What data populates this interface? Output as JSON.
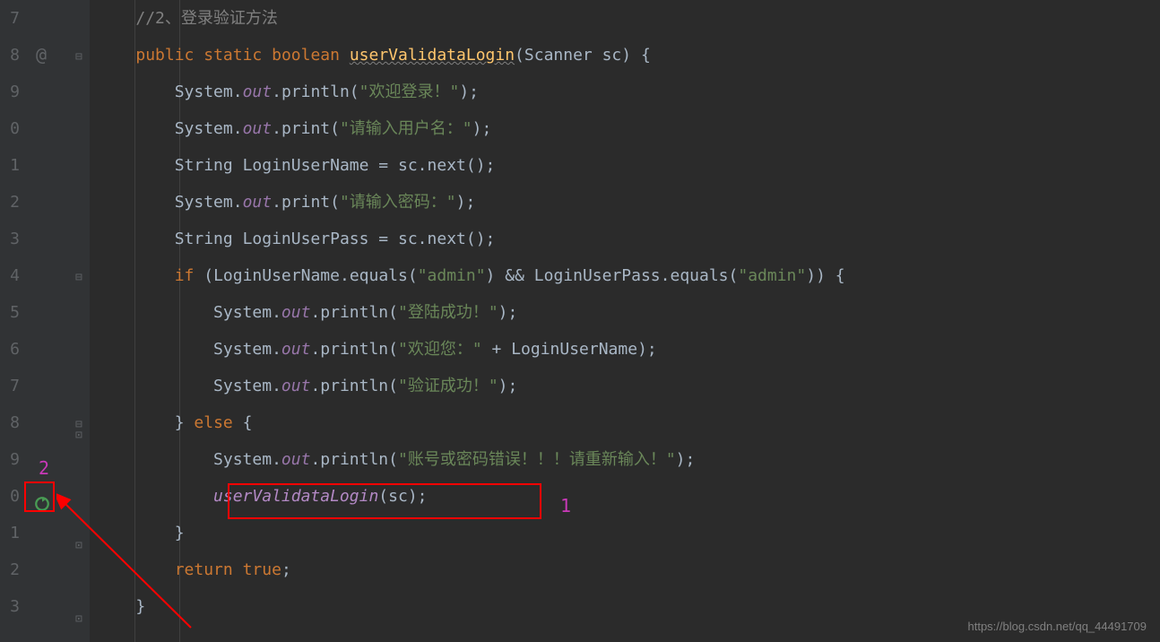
{
  "line_numbers": [
    "7",
    "8",
    "9",
    "0",
    "1",
    "2",
    "3",
    "4",
    "5",
    "6",
    "7",
    "8",
    "9",
    "0",
    "1",
    "2",
    "3"
  ],
  "code": {
    "comment_line": "//2、登录验证方法",
    "public": "public",
    "static": "static",
    "boolean": "boolean",
    "method_name": "userValidataLogin",
    "scanner": "Scanner",
    "sc": "sc",
    "system": "System",
    "out": "out",
    "println": "println",
    "print": "print",
    "str_welcome": "\"欢迎登录！\"",
    "str_username_prompt": "\"请输入用户名：\"",
    "string_type": "String",
    "loginUserName": "LoginUserName",
    "equals_assign": " = ",
    "next": "next",
    "str_password_prompt": "\"请输入密码：\"",
    "loginUserPass": "LoginUserPass",
    "if": "if",
    "equals_method": "equals",
    "str_admin": "\"admin\"",
    "and_op": "&&",
    "str_login_success": "\"登陆成功！\"",
    "str_welcome_user": "\"欢迎您：\"",
    "plus": " + ",
    "str_verify_success": "\"验证成功！\"",
    "else": "else",
    "str_error": "\"账号或密码错误！！！请重新输入！\"",
    "recursive_call": "userValidataLogin",
    "return": "return",
    "true": "true"
  },
  "annotations": {
    "label1": "1",
    "label2": "2"
  },
  "watermark": "https://blog.csdn.net/qq_44491709"
}
